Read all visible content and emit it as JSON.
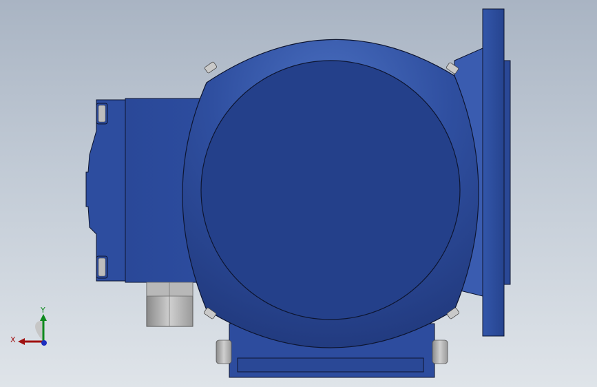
{
  "viewport": {
    "background_top": "#a9b4c3",
    "background_bottom": "#dfe4e9"
  },
  "model": {
    "body_color": "#2b4a99",
    "body_dark": "#233d80",
    "highlight": "#4a6fc0",
    "bolt_color": "#c9c9c9",
    "outline_color": "#0d1530"
  },
  "triad": {
    "x_label": "X",
    "y_label": "Y",
    "x_color": "#a01010",
    "y_color": "#0e8a1e",
    "z_color": "#1e2fbf"
  }
}
